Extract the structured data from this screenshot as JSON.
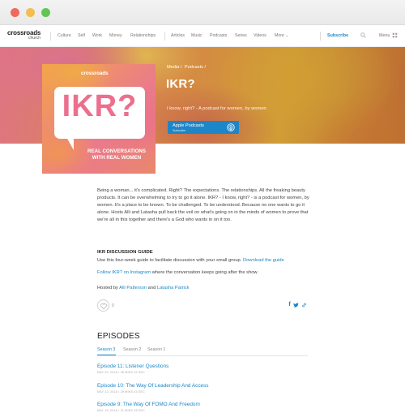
{
  "window": {
    "controls": [
      "close",
      "minimize",
      "maximize"
    ]
  },
  "header": {
    "logo_line1": "crossroads",
    "logo_line2": "church",
    "nav_left": [
      "Culture",
      "Self",
      "Work",
      "Money",
      "Relationships"
    ],
    "nav_right": [
      "Articles",
      "Music",
      "Podcasts",
      "Series",
      "Videos",
      "More ⌄"
    ],
    "subscribe": "Subscribe",
    "menu": "Menu",
    "icons": [
      "search-icon",
      "menu-icon"
    ]
  },
  "hero": {
    "breadcrumb": [
      "Media /",
      "Podcasts /"
    ],
    "title": "IKR?",
    "tagline": "I know, right? - A podcast for women, by women",
    "apple_label": "Apple Podcasts",
    "apple_sub": "Subscribe",
    "colors": {
      "button": "#1d86c8"
    }
  },
  "cover": {
    "brand": "crossroads",
    "title": "IKR?",
    "subtitle_line1": "REAL CONVERSATIONS",
    "subtitle_line2": "WITH REAL WOMEN"
  },
  "content": {
    "description": "Being a woman... it's complicated. Right? The expectations. The relationships. All the freaking beauty products. It can be overwhelming to try to go it alone. IKR? - I know, right? - is a podcast for women, by women. It's a place to be known. To be challenged. To be understood. Because no one wants to go it alone. Hosts Alli and Latasha pull back the veil on what's going on in the minds of women to prove that we're all in this together and there's a God who wants in on it too.",
    "guide_title": "IKR DISCUSSION GUIDE",
    "guide_text": "Use this four-week guide to facilitate discussion with your small group.",
    "guide_link": "Download the guide",
    "insta_link": "Follow IKR? on Instagram",
    "insta_text": "where the conversation keeps going after the show.",
    "hosted_prefix": "Hosted by",
    "host1": "Alli Patterson",
    "hosted_and": "and",
    "host2": "Latasha Patrick",
    "like_count": "0",
    "share_icons": [
      "facebook-icon",
      "twitter-icon",
      "link-icon"
    ]
  },
  "episodes": {
    "heading": "EPISODES",
    "tabs": [
      "Season 3",
      "Season 2",
      "Season 1"
    ],
    "active_tab": "Season 3",
    "items": [
      {
        "title": "Episode 11: Listener Questions",
        "meta": "MAY 29, 2018 • 38 MINS 16 SEC"
      },
      {
        "title": "Episode 10: The Way Of Leadership And Access",
        "meta": "MAY 22, 2018 • 29 MINS 43 SEC"
      },
      {
        "title": "Episode 9: The Way Of FOMO And Freedom",
        "meta": "MAY 15, 2018 • 31 MINS 28 SEC"
      }
    ]
  }
}
